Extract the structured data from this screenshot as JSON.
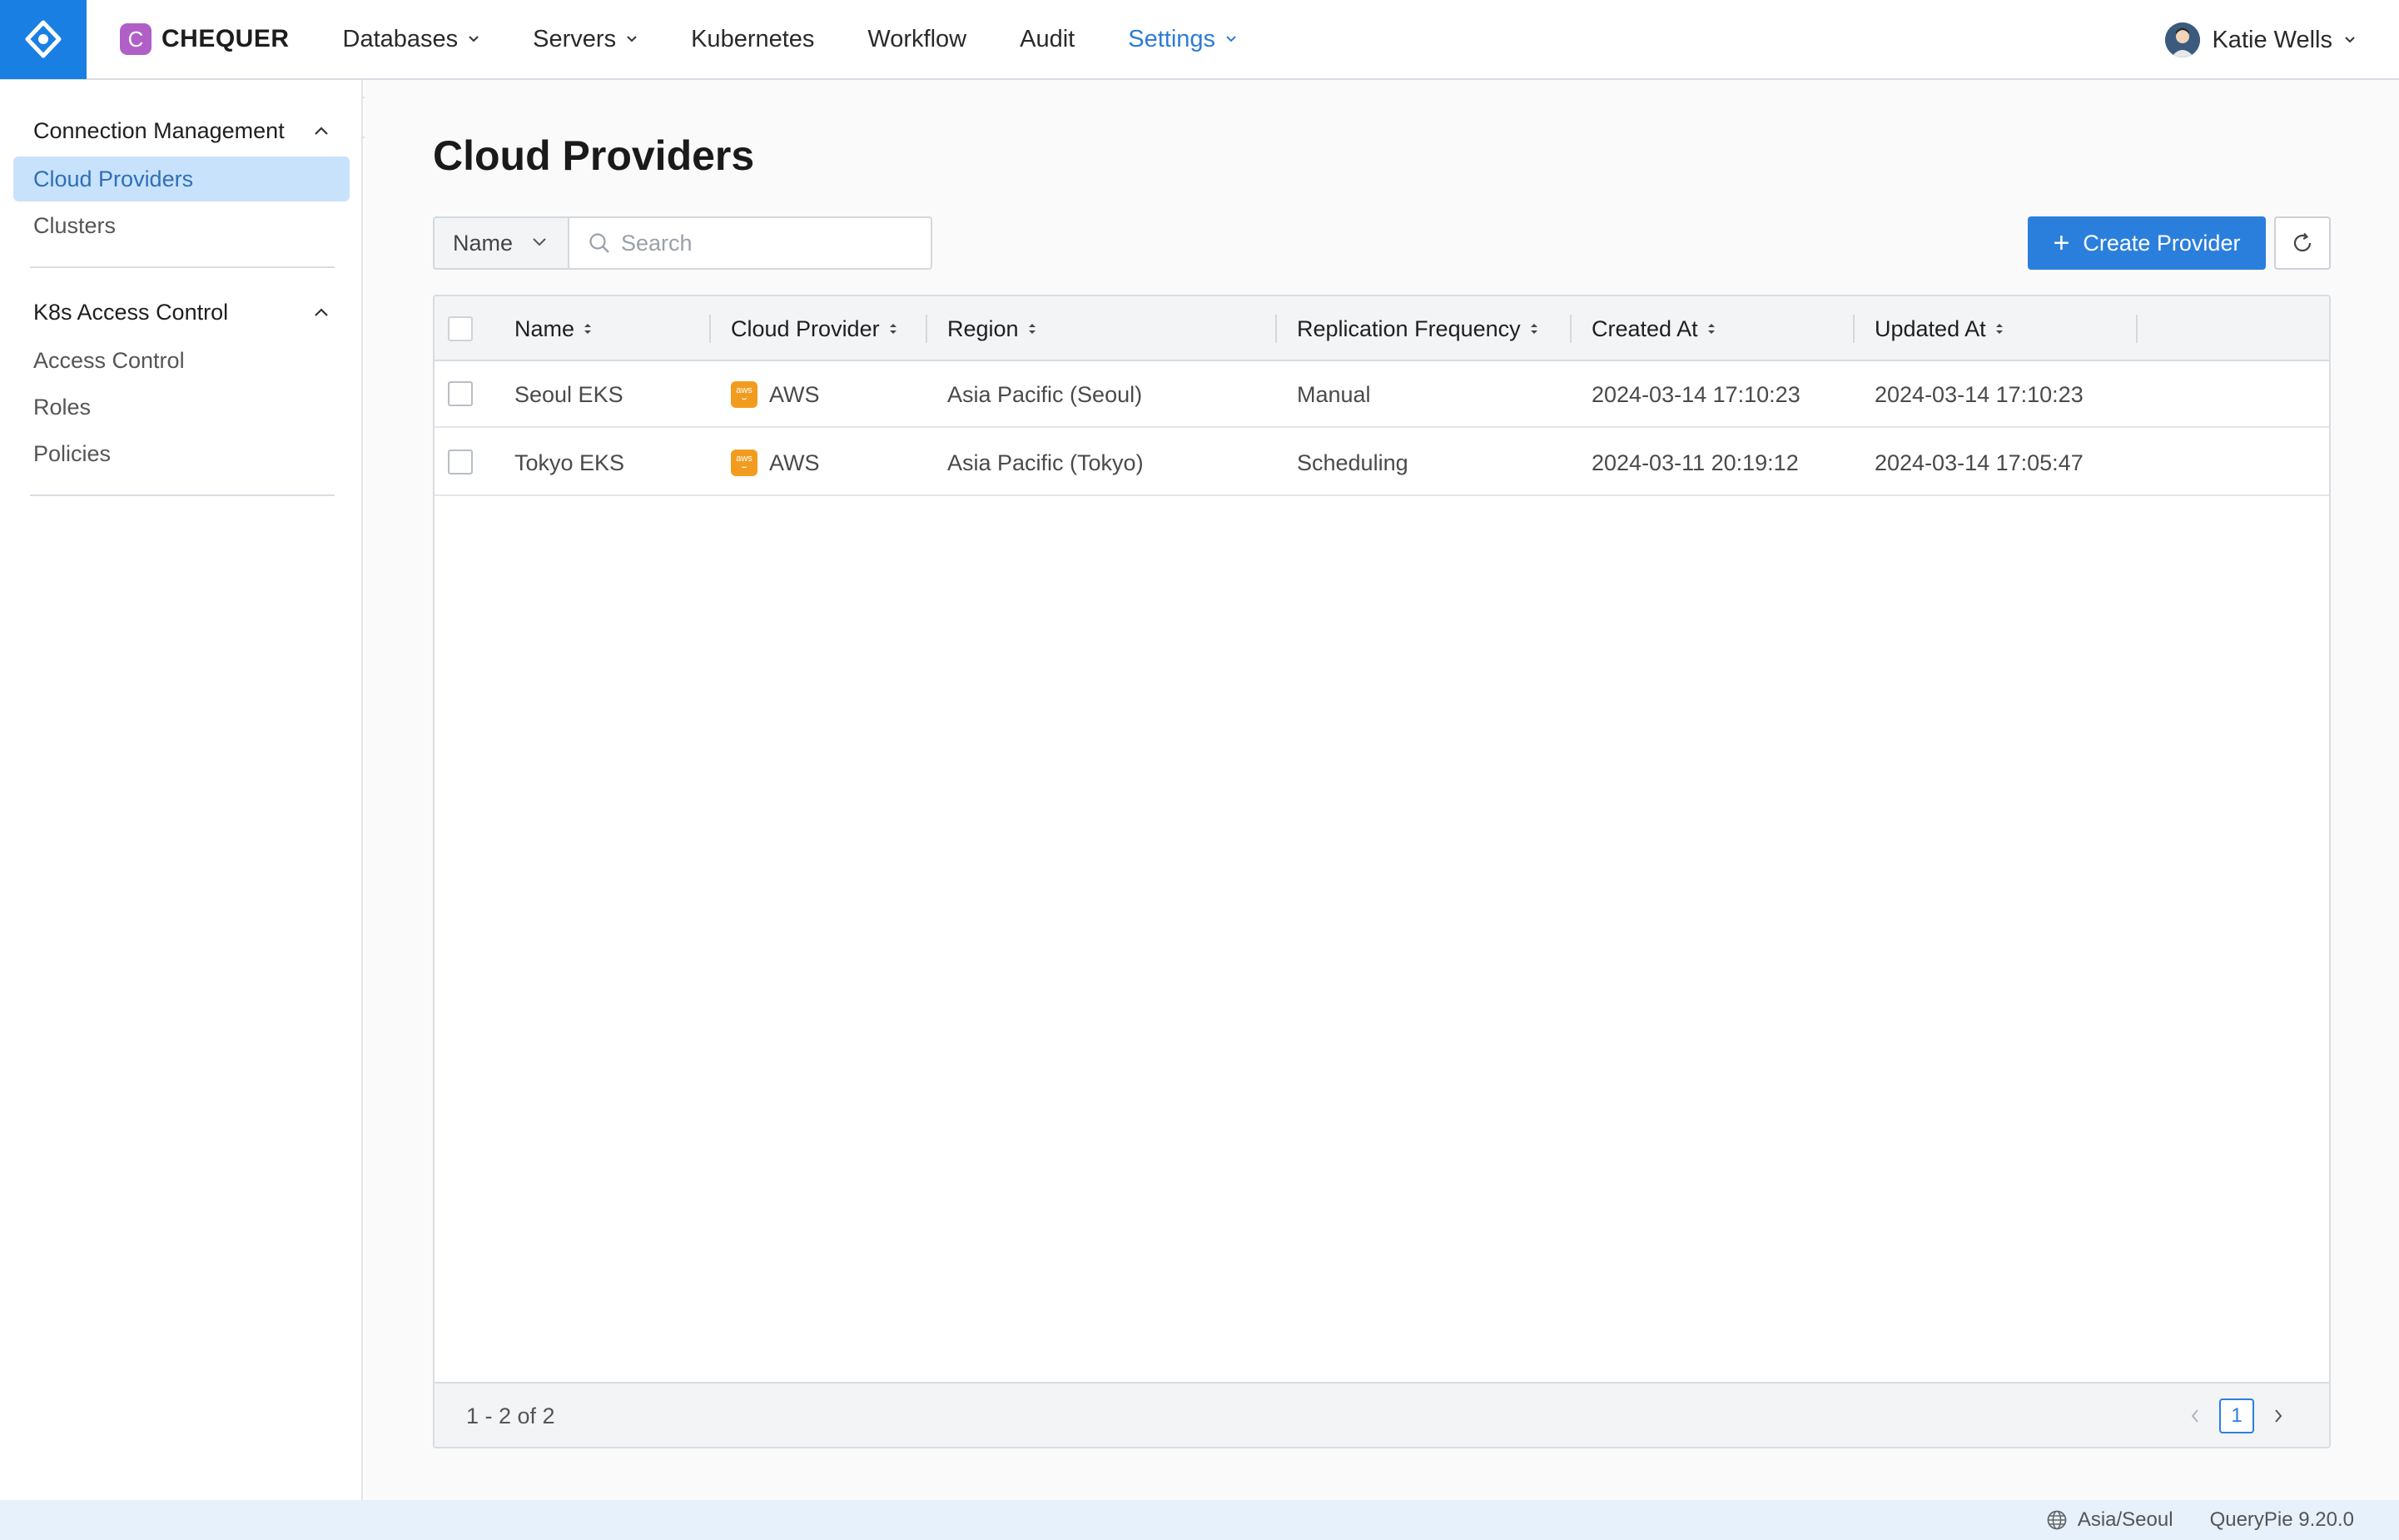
{
  "brand": {
    "badge": "C",
    "name": "CHEQUER"
  },
  "nav": {
    "items": [
      {
        "label": "Databases",
        "dropdown": true,
        "active": false
      },
      {
        "label": "Servers",
        "dropdown": true,
        "active": false
      },
      {
        "label": "Kubernetes",
        "dropdown": false,
        "active": false
      },
      {
        "label": "Workflow",
        "dropdown": false,
        "active": false
      },
      {
        "label": "Audit",
        "dropdown": false,
        "active": false
      },
      {
        "label": "Settings",
        "dropdown": true,
        "active": true
      }
    ]
  },
  "user": {
    "name": "Katie Wells"
  },
  "sidebar": {
    "sections": [
      {
        "title": "Connection Management",
        "items": [
          {
            "label": "Cloud Providers",
            "active": true
          },
          {
            "label": "Clusters",
            "active": false
          }
        ]
      },
      {
        "title": "K8s Access Control",
        "items": [
          {
            "label": "Access Control",
            "active": false
          },
          {
            "label": "Roles",
            "active": false
          },
          {
            "label": "Policies",
            "active": false
          }
        ]
      }
    ]
  },
  "page": {
    "title": "Cloud Providers"
  },
  "filter": {
    "field": "Name",
    "search_placeholder": "Search",
    "search_value": ""
  },
  "actions": {
    "create_label": "Create Provider"
  },
  "table": {
    "columns": [
      "Name",
      "Cloud Provider",
      "Region",
      "Replication Frequency",
      "Created At",
      "Updated At"
    ],
    "rows": [
      {
        "name": "Seoul EKS",
        "provider": "AWS",
        "region": "Asia Pacific (Seoul)",
        "frequency": "Manual",
        "created": "2024-03-14 17:10:23",
        "updated": "2024-03-14 17:10:23"
      },
      {
        "name": "Tokyo EKS",
        "provider": "AWS",
        "region": "Asia Pacific (Tokyo)",
        "frequency": "Scheduling",
        "created": "2024-03-11 20:19:12",
        "updated": "2024-03-14 17:05:47"
      }
    ],
    "range_text": "1 - 2 of 2",
    "current_page": "1"
  },
  "status": {
    "timezone": "Asia/Seoul",
    "version": "QueryPie 9.20.0"
  },
  "colors": {
    "primary": "#2b7fdc",
    "logo_bg": "#1a7fe3",
    "brand_badge": "#b05fc6",
    "aws": "#f29c1f",
    "active_nav": "#2e7bd6",
    "sidebar_active_bg": "#c8e2fb"
  }
}
